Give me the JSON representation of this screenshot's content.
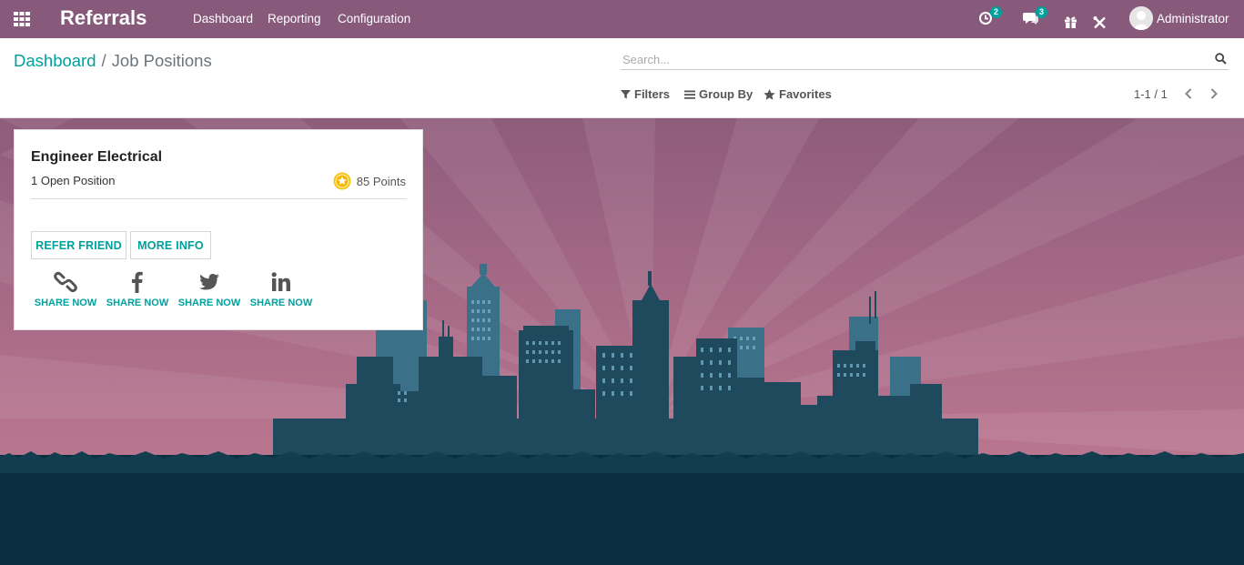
{
  "navbar": {
    "app_title": "Referrals",
    "menu": [
      "Dashboard",
      "Reporting",
      "Configuration"
    ],
    "activity_count": "2",
    "message_count": "3",
    "user_name": "Administrator"
  },
  "breadcrumb": {
    "parent": "Dashboard",
    "separator": "/",
    "current": "Job Positions"
  },
  "search": {
    "placeholder": "Search...",
    "value": ""
  },
  "search_options": {
    "filters": "Filters",
    "group_by": "Group By",
    "favorites": "Favorites"
  },
  "pager": {
    "value": "1-1 / 1"
  },
  "job_card": {
    "title": "Engineer Electrical",
    "open_positions": "1 Open Position",
    "points": "85 Points",
    "refer_button": "REFER FRIEND",
    "more_info_button": "MORE INFO",
    "shares": [
      {
        "icon": "link-icon",
        "label": "SHARE NOW"
      },
      {
        "icon": "facebook-icon",
        "label": "SHARE NOW"
      },
      {
        "icon": "twitter-icon",
        "label": "SHARE NOW"
      },
      {
        "icon": "linkedin-icon",
        "label": "SHARE NOW"
      }
    ]
  },
  "colors": {
    "navbar": "#875a7b",
    "accent": "#00a09d",
    "sky_top": "#8f5c7c",
    "sky_bottom": "#c77e95",
    "city_dark": "#1f4a5e",
    "city_light": "#3b7089",
    "ground": "#0a3040"
  }
}
